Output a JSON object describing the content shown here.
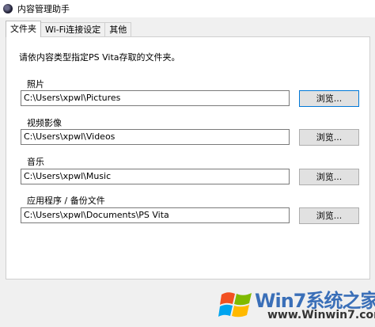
{
  "window": {
    "title": "内容管理助手"
  },
  "tabs": [
    {
      "label": "文件夹"
    },
    {
      "label": "Wi-Fi连接设定"
    },
    {
      "label": "其他"
    }
  ],
  "instruction": "请依内容类型指定PS Vita存取的文件夹。",
  "groups": [
    {
      "label": "照片",
      "path": "C:\\Users\\xpwl\\Pictures",
      "button": "浏览..."
    },
    {
      "label": "视频影像",
      "path": "C:\\Users\\xpwl\\Videos",
      "button": "浏览..."
    },
    {
      "label": "音乐",
      "path": "C:\\Users\\xpwl\\Music",
      "button": "浏览..."
    },
    {
      "label": "应用程序 / 备份文件",
      "path": "C:\\Users\\xpwl\\Documents\\PS Vita",
      "button": "浏览..."
    }
  ],
  "watermark": {
    "brand": "Win7系统之家",
    "url": "www.Winwin7.com"
  },
  "colors": {
    "focus": "#0078d7",
    "brand": "#3a6fb8"
  },
  "icons": {
    "app": "app-icon",
    "logo": "windows-logo-icon"
  }
}
